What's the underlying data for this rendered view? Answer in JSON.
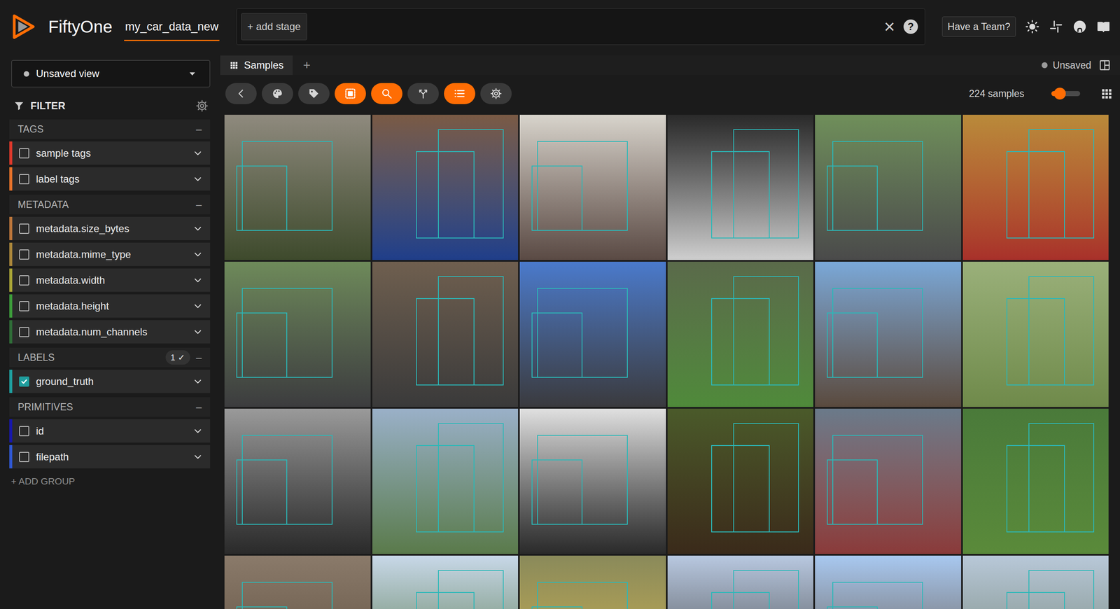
{
  "header": {
    "brand": "FiftyOne",
    "dataset": "my_car_data_new",
    "add_stage": "+ add stage",
    "clear": "×",
    "help": "?",
    "team_button": "Have a Team?"
  },
  "view_selector": {
    "label": "Unsaved view"
  },
  "sidebar": {
    "filter_title": "FILTER",
    "groups": [
      {
        "name": "TAGS",
        "toggle": "–",
        "items": [
          {
            "name": "sample tags",
            "checked": false,
            "color": "#d9382b"
          },
          {
            "name": "label tags",
            "checked": false,
            "color": "#e2702a"
          }
        ]
      },
      {
        "name": "METADATA",
        "toggle": "–",
        "items": [
          {
            "name": "metadata.size_bytes",
            "checked": false,
            "color": "#b8743a"
          },
          {
            "name": "metadata.mime_type",
            "checked": false,
            "color": "#a8853a"
          },
          {
            "name": "metadata.width",
            "checked": false,
            "color": "#a6a236"
          },
          {
            "name": "metadata.height",
            "checked": false,
            "color": "#3c9a3a"
          },
          {
            "name": "metadata.num_channels",
            "checked": false,
            "color": "#2f6b37"
          }
        ]
      },
      {
        "name": "LABELS",
        "toggle": "–",
        "badge": {
          "count": "1",
          "check": "✓"
        },
        "items": [
          {
            "name": "ground_truth",
            "checked": true,
            "color": "#1f9d9d"
          }
        ]
      },
      {
        "name": "PRIMITIVES",
        "toggle": "–",
        "items": [
          {
            "name": "id",
            "checked": false,
            "color": "#1818a8"
          },
          {
            "name": "filepath",
            "checked": false,
            "color": "#2f56cf"
          }
        ]
      }
    ],
    "add_group": "+ ADD GROUP"
  },
  "tabs": [
    {
      "label": "Samples",
      "selected": true
    }
  ],
  "add_tab": "+",
  "view_status": "Unsaved",
  "toolbar": {
    "buttons": [
      {
        "kind": "back",
        "active": false
      },
      {
        "kind": "palette",
        "active": false
      },
      {
        "kind": "tag",
        "active": false
      },
      {
        "kind": "select",
        "active": true
      },
      {
        "kind": "search",
        "active": true
      },
      {
        "kind": "merge",
        "active": false
      },
      {
        "kind": "list",
        "active": true
      },
      {
        "kind": "gear",
        "active": false
      }
    ]
  },
  "sample_count": "224 samples",
  "zoom": {
    "level": 0.3
  }
}
